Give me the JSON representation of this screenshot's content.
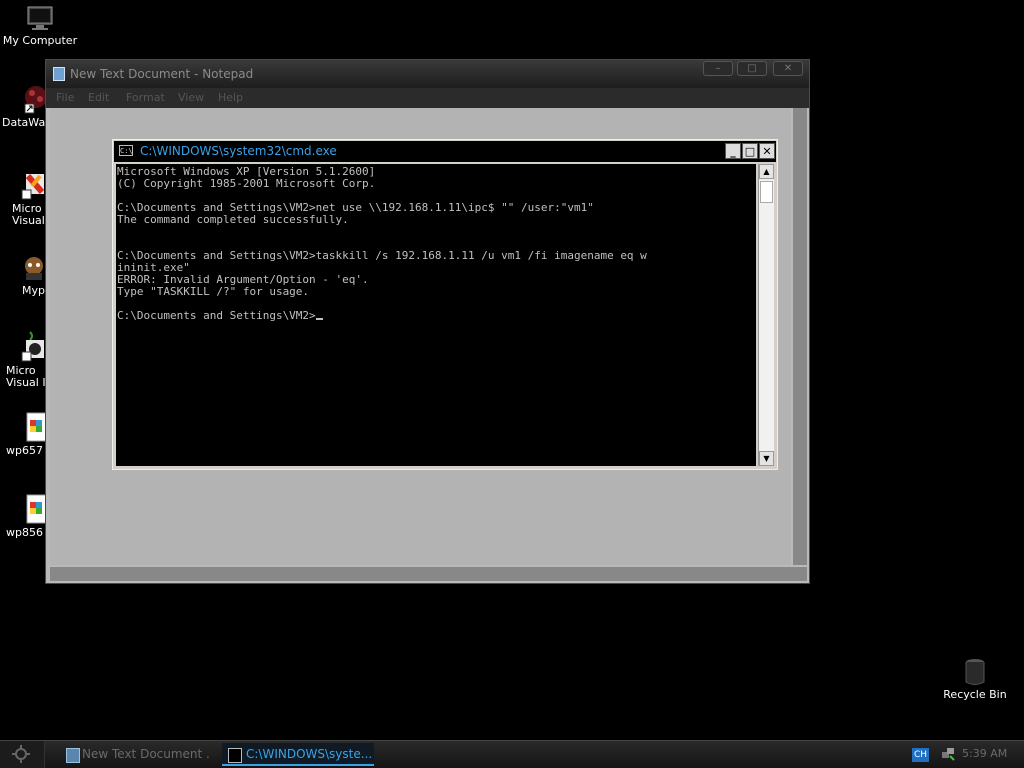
{
  "desktop": {
    "icons": [
      {
        "label": "My Computer"
      },
      {
        "label": "DataWa"
      },
      {
        "label": "Micro\nVisual"
      },
      {
        "label": "Myp"
      },
      {
        "label": "Micro\nVisual I"
      },
      {
        "label": "wp657"
      },
      {
        "label": "wp856"
      },
      {
        "label": "Recycle Bin"
      }
    ]
  },
  "notepad": {
    "title": "New Text Document - Notepad",
    "menu": [
      "File",
      "Edit",
      "Format",
      "View",
      "Help"
    ]
  },
  "cmd": {
    "title": "C:\\WINDOWS\\system32\\cmd.exe",
    "lines": [
      "Microsoft Windows XP [Version 5.1.2600]",
      "(C) Copyright 1985-2001 Microsoft Corp.",
      "",
      "C:\\Documents and Settings\\VM2>net use \\\\192.168.1.11\\ipc$ \"\" /user:\"vm1\"",
      "The command completed successfully.",
      "",
      "",
      "C:\\Documents and Settings\\VM2>taskkill /s 192.168.1.11 /u vm1 /fi imagename eq w",
      "ininit.exe\"",
      "ERROR: Invalid Argument/Option - 'eq'.",
      "Type \"TASKKILL /?\" for usage.",
      ""
    ],
    "prompt": "C:\\Documents and Settings\\VM2>"
  },
  "taskbar": {
    "tasks": [
      {
        "label": "New Text Document ..."
      },
      {
        "label": "C:\\WINDOWS\\syste..."
      }
    ],
    "tray": {
      "language": "CH",
      "clock": "5:39 AM"
    }
  },
  "colors": {
    "accent": "#3aa2e8",
    "desktop": "#000000"
  }
}
